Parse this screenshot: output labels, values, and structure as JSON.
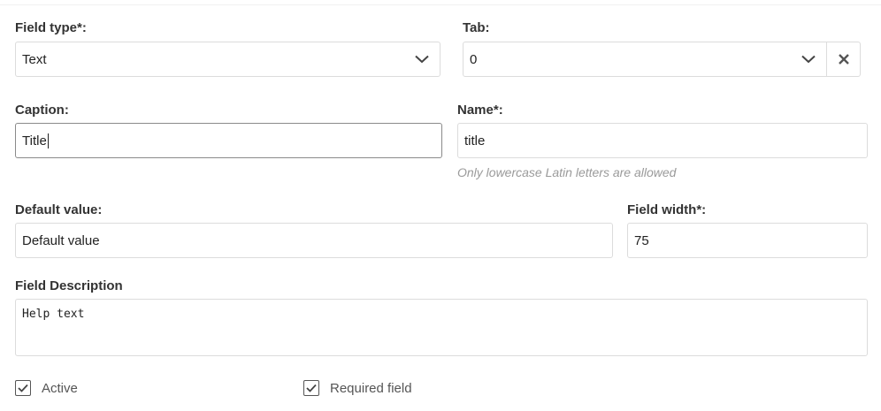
{
  "form": {
    "field_type": {
      "label": "Field type*:",
      "value": "Text"
    },
    "tab": {
      "label": "Tab:",
      "value": "0"
    },
    "caption": {
      "label": "Caption:",
      "value": "Title"
    },
    "name": {
      "label": "Name*:",
      "value": "title",
      "hint": "Only lowercase Latin letters are allowed"
    },
    "default_value": {
      "label": "Default value:",
      "value": "Default value"
    },
    "field_width": {
      "label": "Field width*:",
      "value": "75"
    },
    "description": {
      "label": "Field Description",
      "value": "Help text"
    },
    "active": {
      "label": "Active",
      "checked": true
    },
    "required": {
      "label": "Required field",
      "checked": true
    }
  },
  "icons": {
    "field_type_dropdown": "chevron-down-icon",
    "tab_dropdown": "chevron-down-icon",
    "tab_clear": "close-icon",
    "active_check": "checkmark-icon",
    "required_check": "checkmark-icon"
  },
  "colors": {
    "border": "#dcdcdc",
    "focused_border": "#8a8a8a",
    "hint": "#9a9a9a",
    "label": "#333333"
  }
}
